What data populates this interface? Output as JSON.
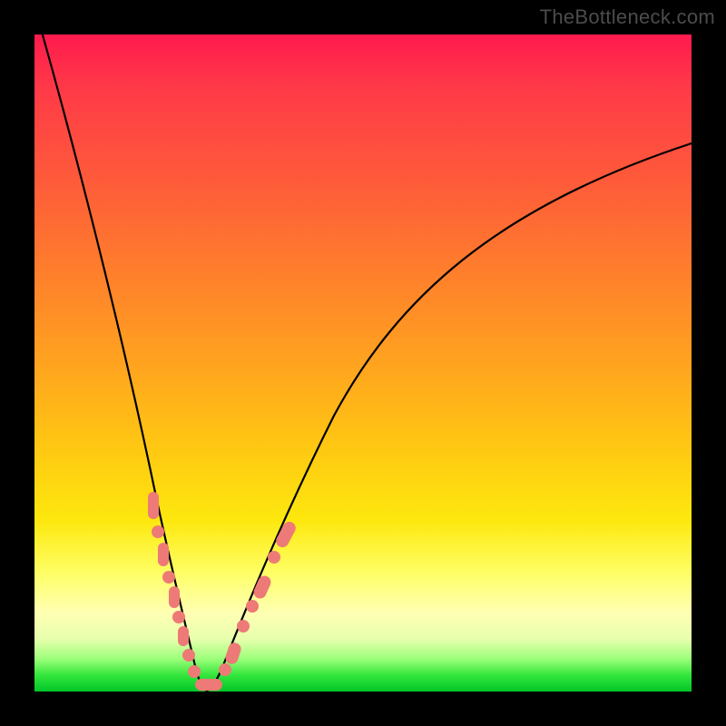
{
  "watermark": "TheBottleneck.com",
  "chart_data": {
    "type": "line",
    "title": "",
    "xlabel": "",
    "ylabel": "",
    "xlim": [
      0,
      100
    ],
    "ylim": [
      0,
      100
    ],
    "x": [
      0,
      4,
      8,
      12,
      16,
      18,
      20,
      22,
      23,
      24,
      25,
      26,
      27,
      28,
      30,
      32,
      36,
      40,
      46,
      52,
      60,
      70,
      80,
      90,
      100
    ],
    "y": [
      100,
      85,
      70,
      54,
      38,
      30,
      22,
      13,
      8,
      4,
      1,
      0,
      1,
      3,
      8,
      14,
      24,
      33,
      44,
      53,
      62,
      70,
      76,
      80,
      83
    ],
    "minimum_x": 26,
    "highlighted_points": {
      "left_branch_x": [
        18.2,
        19.2,
        20.4,
        21.3,
        22.0,
        22.8,
        23.4,
        24.1,
        24.8
      ],
      "left_branch_y": [
        29.0,
        25.0,
        20.0,
        16.0,
        13.0,
        9.0,
        6.5,
        4.0,
        1.5
      ],
      "bottom_x": [
        25.4,
        26.0,
        26.6,
        27.2
      ],
      "bottom_y": [
        0.3,
        0.1,
        0.3,
        0.9
      ],
      "right_branch_x": [
        28.5,
        29.2,
        30.2,
        31.2,
        32.4,
        33.6,
        35.0
      ],
      "right_branch_y": [
        4.0,
        6.0,
        9.0,
        12.0,
        15.5,
        19.0,
        23.0
      ]
    },
    "background_gradient_stops": [
      {
        "pos": 0.0,
        "color": "#ff1a4e"
      },
      {
        "pos": 0.5,
        "color": "#ffa31f"
      },
      {
        "pos": 0.82,
        "color": "#feff66"
      },
      {
        "pos": 0.95,
        "color": "#9dff7b"
      },
      {
        "pos": 1.0,
        "color": "#00c628"
      }
    ]
  }
}
